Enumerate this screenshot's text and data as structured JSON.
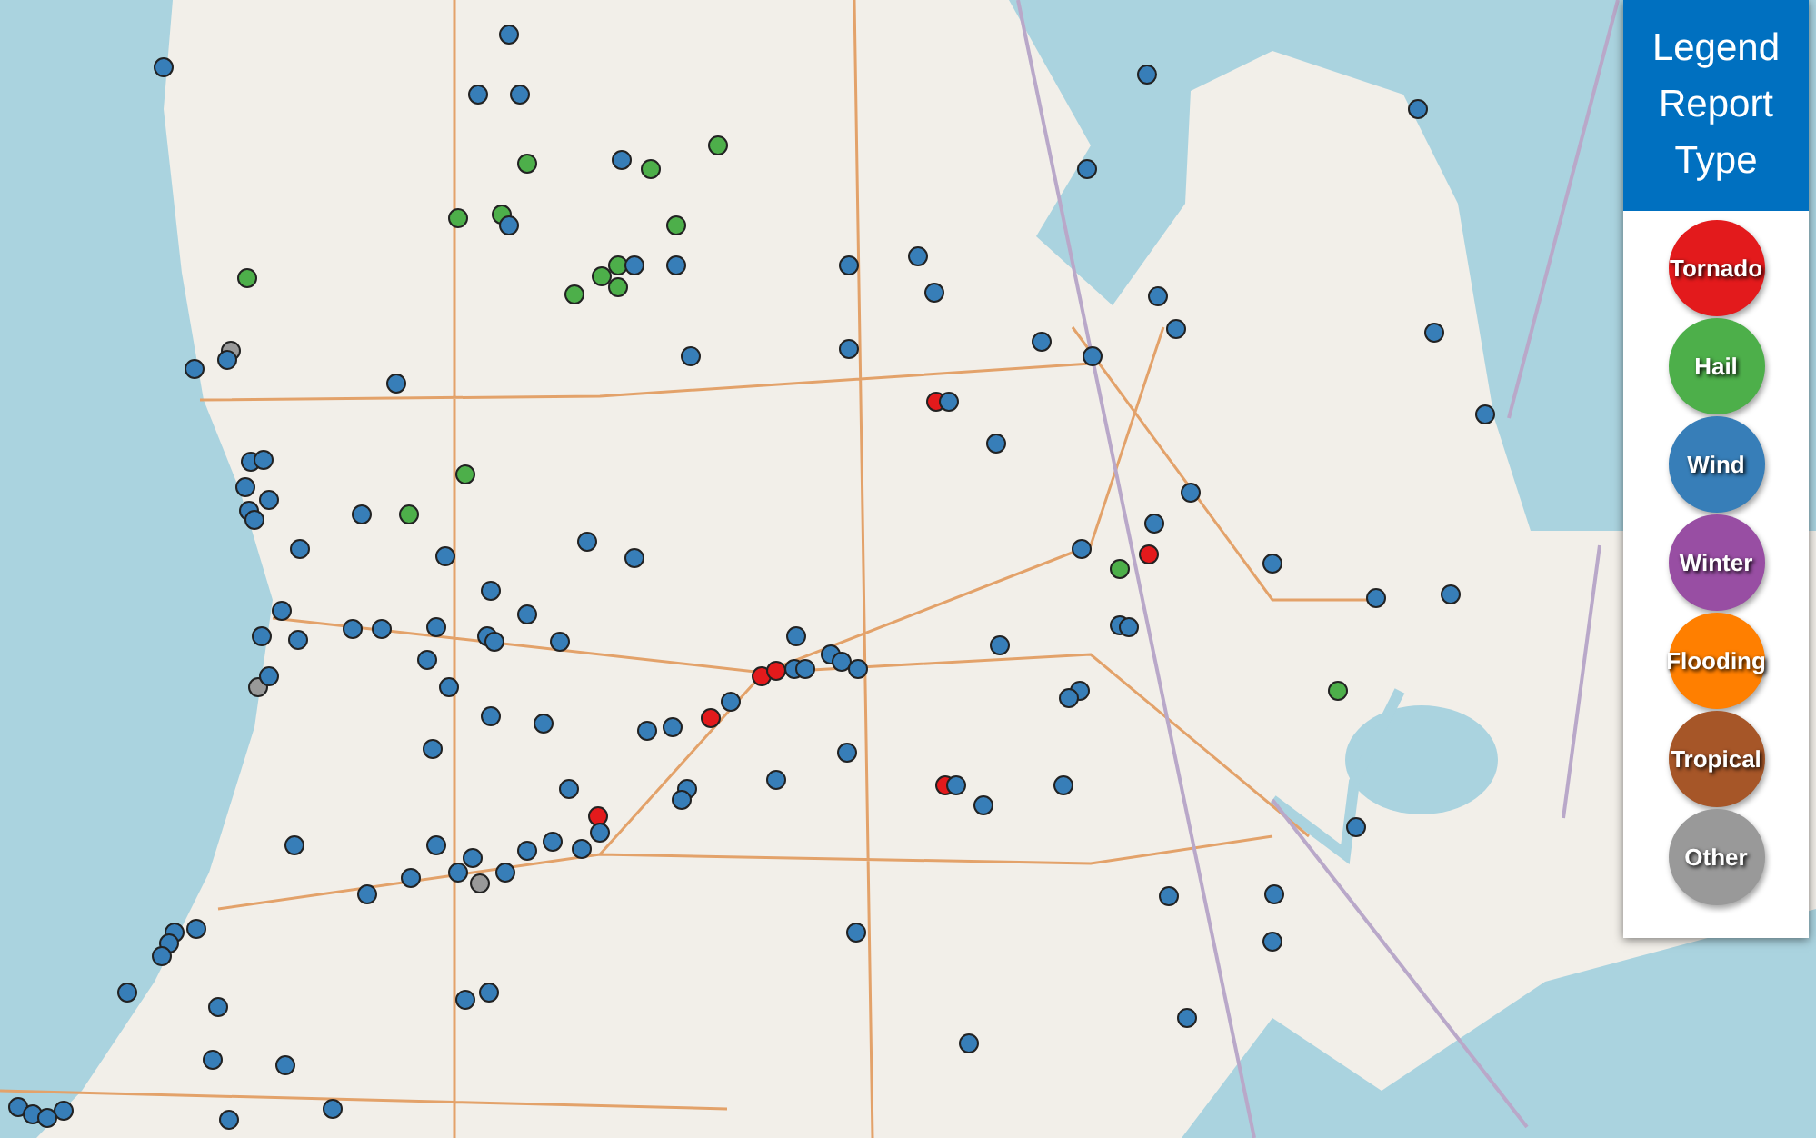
{
  "legend": {
    "title": "Legend Report Type",
    "items": [
      {
        "label": "Tornado",
        "color": "#e31a1c"
      },
      {
        "label": "Hail",
        "color": "#4daf4a"
      },
      {
        "label": "Wind",
        "color": "#377eb8"
      },
      {
        "label": "Winter",
        "color": "#984ea3"
      },
      {
        "label": "Flooding",
        "color": "#ff7f00"
      },
      {
        "label": "Tropical",
        "color": "#a65628"
      },
      {
        "label": "Other",
        "color": "#999999"
      }
    ]
  }
}
